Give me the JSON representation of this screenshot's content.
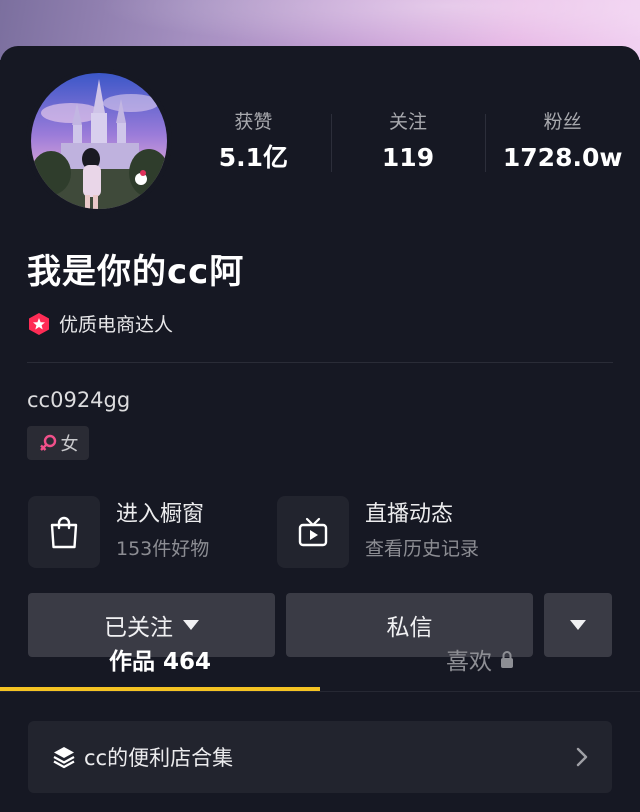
{
  "profile": {
    "name": "我是你的cc阿",
    "badge": "优质电商达人",
    "uid": "cc0924gg",
    "gender": "女"
  },
  "stats": [
    {
      "label": "获赞",
      "value": "5.1亿"
    },
    {
      "label": "关注",
      "value": "119"
    },
    {
      "label": "粉丝",
      "value": "1728.0w"
    }
  ],
  "features": {
    "shop": {
      "title": "进入橱窗",
      "subtitle": "153件好物",
      "icon": "shopping-bag-icon"
    },
    "live": {
      "title": "直播动态",
      "subtitle": "查看历史记录",
      "icon": "tv-play-icon"
    }
  },
  "actions": {
    "follow_label": "已关注",
    "message_label": "私信"
  },
  "tabs": {
    "works": "作品 464",
    "likes": "喜欢"
  },
  "collection": {
    "label": "cc的便利店合集"
  },
  "colors": {
    "background": "#161823",
    "accent_underline": "#f5c323",
    "badge": "#fe2c55"
  }
}
